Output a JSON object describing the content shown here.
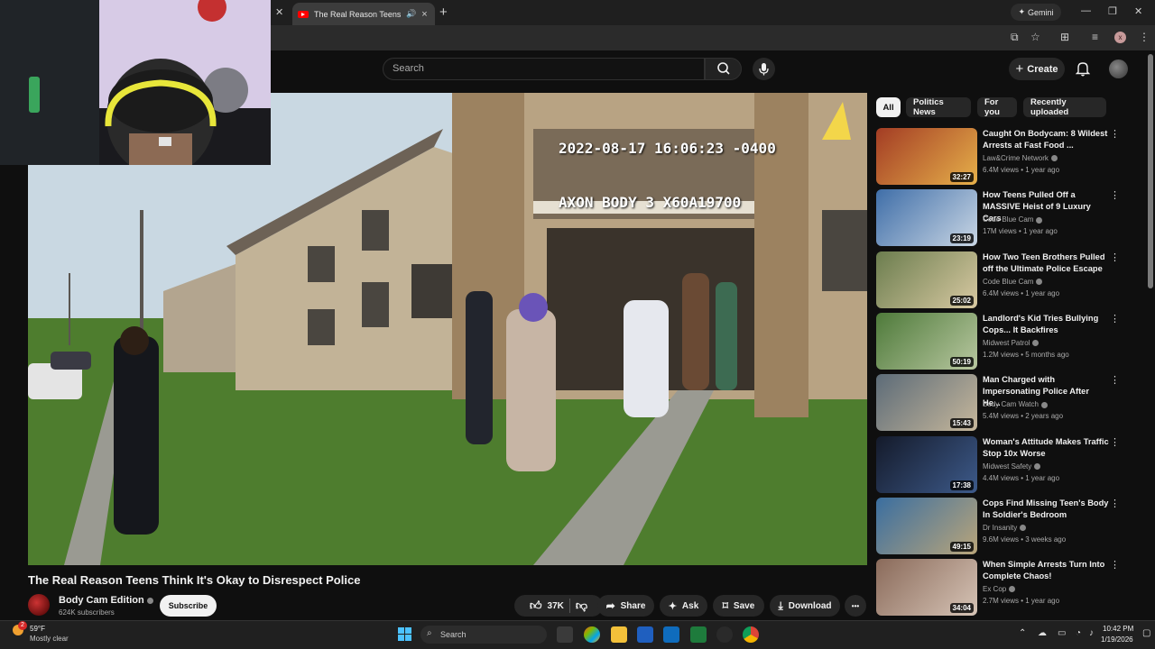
{
  "browser": {
    "tab_title": "The Real Reason Teens Thi",
    "tab_close": "×",
    "new_tab": "+",
    "gemini_label": "Gemini",
    "minimize": "—",
    "maximize": "❐",
    "close": "✕",
    "profile_initial": "x"
  },
  "header": {
    "search_placeholder": "Search",
    "create_label": "Create"
  },
  "video": {
    "timestamp_line1": "2022-08-17 16:06:23 -0400",
    "timestamp_line2": "AXON BODY 3 X60A19700",
    "title": "The Real Reason Teens Think It's Okay to Disrespect Police"
  },
  "channel": {
    "name": "Body Cam Edition",
    "subscribers": "624K subscribers",
    "subscribe_label": "Subscribe"
  },
  "actions": {
    "likes": "37K",
    "share": "Share",
    "ask": "Ask",
    "save": "Save",
    "download": "Download",
    "more": "•••"
  },
  "chips": [
    "All",
    "Politics News",
    "For you",
    "Recently uploaded"
  ],
  "recommendations": [
    {
      "title": "Caught On Bodycam: 8 Wildest Arrests at Fast Food ...",
      "channel": "Law&Crime Network",
      "meta": "6.4M views • 1 year ago",
      "duration": "32:27",
      "colors": [
        "#a33c24",
        "#e6b04a"
      ]
    },
    {
      "title": "How Teens Pulled Off a MASSIVE Heist of 9 Luxury Cars",
      "channel": "Code Blue Cam",
      "meta": "17M views • 1 year ago",
      "duration": "23:19",
      "colors": [
        "#3f6ea8",
        "#c9d6e4"
      ]
    },
    {
      "title": "How Two Teen Brothers Pulled off the Ultimate Police Escape",
      "channel": "Code Blue Cam",
      "meta": "6.4M views • 1 year ago",
      "duration": "25:02",
      "colors": [
        "#6b7d4e",
        "#d8c9a2"
      ]
    },
    {
      "title": "Landlord's Kid Tries Bullying Cops... It Backfires",
      "channel": "Midwest Patrol",
      "meta": "1.2M views • 5 months ago",
      "duration": "50:19",
      "colors": [
        "#4e7a3a",
        "#b8c7a0"
      ]
    },
    {
      "title": "Man Charged with Impersonating Police After He...",
      "channel": "Body Cam Watch",
      "meta": "5.4M views • 2 years ago",
      "duration": "15:43",
      "colors": [
        "#5c6b78",
        "#c6b79b"
      ]
    },
    {
      "title": "Woman's Attitude Makes Traffic Stop 10x Worse",
      "channel": "Midwest Safety",
      "meta": "4.4M views • 1 year ago",
      "duration": "17:38",
      "colors": [
        "#141a2a",
        "#3d5a8a"
      ]
    },
    {
      "title": "Cops Find Missing Teen's Body In Soldier's Bedroom",
      "channel": "Dr Insanity",
      "meta": "9.6M views • 3 weeks ago",
      "duration": "49:15",
      "colors": [
        "#3a6ea0",
        "#b9a57a"
      ]
    },
    {
      "title": "When Simple Arrests Turn Into Complete Chaos!",
      "channel": "Ex Cop",
      "meta": "2.7M views • 1 year ago",
      "duration": "34:04",
      "colors": [
        "#8a6a5a",
        "#d6c4b6"
      ]
    }
  ],
  "taskbar": {
    "notification_count": "2",
    "weather_temp": "59°F",
    "weather_desc": "Mostly clear",
    "search_label": "Search",
    "time": "10:42 PM",
    "date": "1/19/2026"
  }
}
